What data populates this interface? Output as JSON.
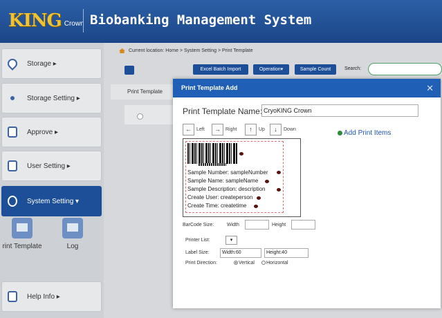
{
  "header": {
    "logo_main": "KING",
    "logo_sub": "Crown",
    "title": "Biobanking Management System"
  },
  "sidebar": {
    "items": [
      {
        "label": "Storage ▸"
      },
      {
        "label": "Storage Setting ▸"
      },
      {
        "label": "Approve ▸"
      },
      {
        "label": "User Setting ▸"
      },
      {
        "label": "System Setting ▾"
      },
      {
        "label": "Help Info ▸"
      }
    ],
    "tiles": [
      {
        "label": "rint Template"
      },
      {
        "label": "Log"
      }
    ]
  },
  "breadcrumb": "Current location: Home > System Setting > Print Template",
  "toolbar": {
    "excel": "Excel Batch Import",
    "operation": "Operation▾",
    "sample_count": "Sample Count",
    "search_label": "Search:"
  },
  "grid": {
    "header": "Print Template"
  },
  "modal": {
    "title": "Print Template Add",
    "close": "✕",
    "name_label": "Print Template Name:",
    "name_value": "CryoKING Crown",
    "directions": {
      "left": "Left",
      "right": "Right",
      "up": "Up",
      "down": "Down"
    },
    "add_items": "Add Print Items",
    "label_lines": [
      "Sample Number: sampleNumber",
      "Sample Name: sampleName",
      "Sample Description: description",
      "Create User: createperson",
      "Create Time: createtime"
    ],
    "barcode_size_label": "BarCode Size:",
    "width_label": "Width",
    "height_label": "Height",
    "printer_list_label": "Printer List:",
    "printer_value": "▾",
    "label_size_label": "Label Size:",
    "label_width": "Width:60",
    "label_height": "Height:40",
    "print_direction_label": "Print Direction:",
    "vertical": "Vertical",
    "horizontal": "Horizontal"
  }
}
